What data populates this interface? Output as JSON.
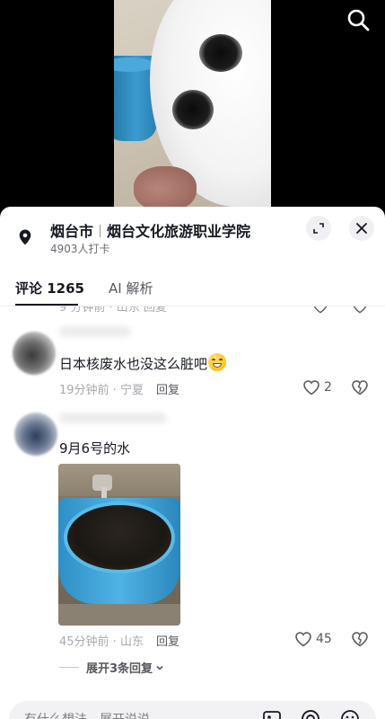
{
  "location": {
    "city": "烟台市",
    "place": "烟台文化旅游职业学院",
    "checkins": "4903人打卡"
  },
  "tabs": {
    "comments_label": "评论",
    "comments_count": "1265",
    "ai_label": "AI 解析"
  },
  "previous_comment_meta": "9 分钟前 · 山东   回复",
  "comments": [
    {
      "text": "日本核废水也没这么脏吧",
      "emoji": "grinning-sweat-emoji",
      "time": "19分钟前",
      "region": "宁夏",
      "reply": "回复",
      "likes": "2"
    },
    {
      "text": "9月6号的水",
      "time": "45分钟前",
      "region": "山东",
      "reply": "回复",
      "likes": "45",
      "more_replies": "展开3条回复"
    }
  ],
  "input": {
    "placeholder": "有什么想法，展开说说"
  },
  "icons": {
    "search": "search-icon",
    "pin": "location-pin-icon",
    "expand": "expand-icon",
    "close": "close-icon",
    "heart": "heart-icon",
    "dislike": "broken-heart-icon",
    "image": "image-icon",
    "at": "at-icon",
    "emoji": "emoji-icon"
  },
  "colors": {
    "text_primary": "#161823",
    "text_secondary": "#a9aab0",
    "sheet_bg": "#ffffff"
  }
}
